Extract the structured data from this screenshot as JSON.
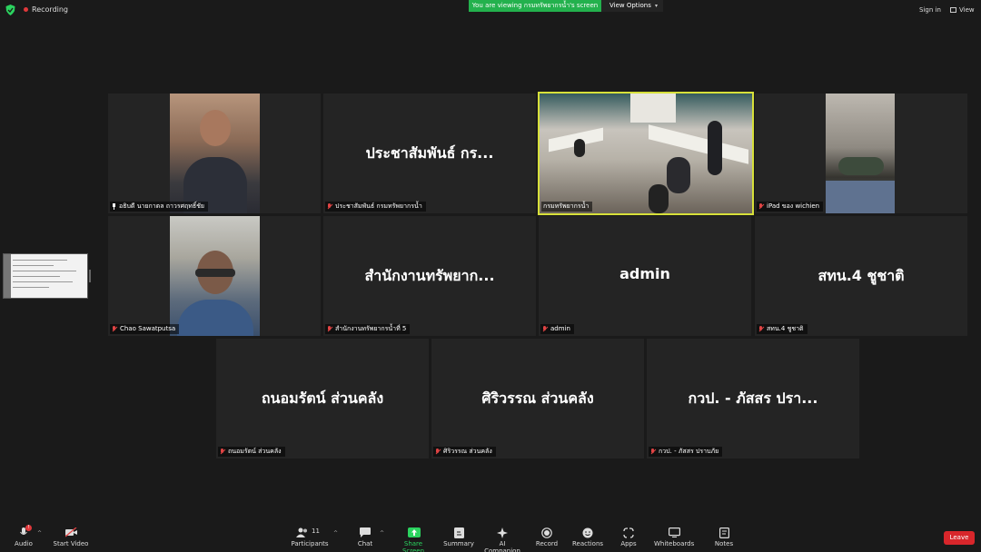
{
  "top": {
    "recording_label": "Recording",
    "banner_text": "You are viewing กรมทรัพยากรน้ำ's screen",
    "view_options_label": "View Options",
    "sign_in_label": "Sign in",
    "view_label": "View"
  },
  "tiles": [
    {
      "display": "",
      "nametag": "อธิบดี นายกาตล ถาวรศฤทธิ์ชัย",
      "icon": "pin-icon",
      "video": true
    },
    {
      "display": "ประชาสัมพันธ์ กร...",
      "nametag": "ประชาสัมพันธ์ กรมทรัพยากรน้ำ",
      "icon": "mute-icon",
      "video": false
    },
    {
      "display": "",
      "nametag": "กรมทรัพยากรน้ำ",
      "icon": "",
      "video": true,
      "active": true
    },
    {
      "display": "",
      "nametag": "iPad ของ wichien",
      "icon": "mute-icon",
      "video": true
    },
    {
      "display": "",
      "nametag": "Chao Sawatputsa",
      "icon": "mute-icon",
      "video": true
    },
    {
      "display": "สำนักงานทรัพยาก...",
      "nametag": "สำนักงานทรัพยากรน้ำที่ 5",
      "icon": "mute-icon",
      "video": false
    },
    {
      "display": "admin",
      "nametag": "admin",
      "icon": "mute-icon",
      "video": false
    },
    {
      "display": "สทน.4 ชูชาติ",
      "nametag": "สทน.4 ชูชาติ",
      "icon": "mute-icon",
      "video": false
    },
    {
      "display": "ถนอมรัตน์  ส่วนคลัง",
      "nametag": "ถนอมรัตน์  ส่วนคลัง",
      "icon": "mute-icon",
      "video": false
    },
    {
      "display": "ศิริวรรณ ส่วนคลัง",
      "nametag": "ศิริวรรณ ส่วนคลัง",
      "icon": "mute-icon",
      "video": false
    },
    {
      "display": "กวป. - ภัสสร ปรา...",
      "nametag": "กวป. - ภัสสร ปราบภัย",
      "icon": "mute-icon",
      "video": false
    }
  ],
  "toolbar": {
    "audio": "Audio",
    "start_video": "Start Video",
    "participants": "Participants",
    "participants_count": "11",
    "chat": "Chat",
    "share_screen": "Share Screen",
    "summary": "Summary",
    "ai_companion": "AI Companion",
    "record": "Record",
    "reactions": "Reactions",
    "apps": "Apps",
    "whiteboards": "Whiteboards",
    "notes": "Notes",
    "leave": "Leave"
  },
  "colors": {
    "background": "#1a1a1a",
    "tile": "#242424",
    "share_banner": "#23b14d",
    "active_speaker": "#d7e03a",
    "leave": "#d8262b",
    "muted": "#e04444"
  }
}
